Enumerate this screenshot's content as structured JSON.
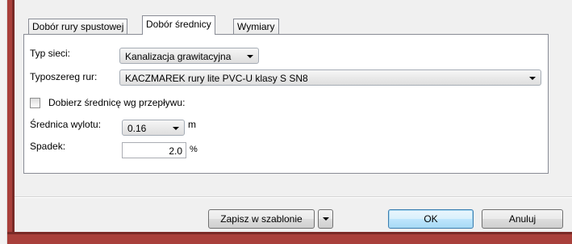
{
  "tabs": [
    {
      "label": "Dobór rury spustowej",
      "active": false
    },
    {
      "label": "Dobór średnicy",
      "active": true
    },
    {
      "label": "Wymiary",
      "active": false
    }
  ],
  "form": {
    "network_type_label": "Typ sieci:",
    "network_type_value": "Kanalizacja grawitacyjna",
    "pipe_series_label": "Typoszereg rur:",
    "pipe_series_value": "KACZMAREK rury lite PVC-U klasy S SN8",
    "flow_checkbox_label": "Dobierz średnicę wg przepływu:",
    "flow_checkbox_checked": false,
    "outlet_diameter_label": "Średnica wylotu:",
    "outlet_diameter_value": "0.16",
    "outlet_diameter_unit": "m",
    "slope_label": "Spadek:",
    "slope_value": "2.0",
    "slope_unit": "%"
  },
  "buttons": {
    "save_template": "Zapisz w szablonie",
    "ok": "OK",
    "cancel": "Anuluj"
  }
}
